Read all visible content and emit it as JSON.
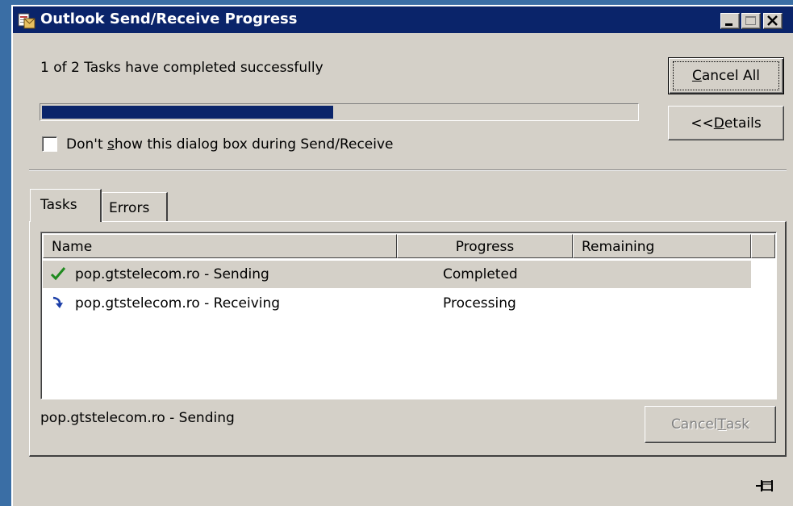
{
  "window": {
    "title": "Outlook Send/Receive Progress"
  },
  "status": {
    "message": "1 of 2 Tasks have completed successfully",
    "progress_fraction": 0.49
  },
  "buttons": {
    "cancel_all": {
      "before": "",
      "mnemonic": "C",
      "after": "ancel All"
    },
    "details": {
      "before": "<< ",
      "mnemonic": "D",
      "after": "etails"
    },
    "cancel_task": {
      "before": "Cancel ",
      "mnemonic": "T",
      "after": "ask"
    }
  },
  "checkbox": {
    "before": "Don't ",
    "mnemonic": "s",
    "after": "how this dialog box during Send/Receive",
    "checked": false
  },
  "tabs": [
    {
      "label": "Tasks",
      "active": true
    },
    {
      "label": "Errors",
      "active": false
    }
  ],
  "task_list": {
    "columns": [
      "Name",
      "Progress",
      "Remaining"
    ],
    "rows": [
      {
        "icon": "checkmark-icon",
        "name": "pop.gtstelecom.ro - Sending",
        "progress": "Completed",
        "remaining": ""
      },
      {
        "icon": "receive-arrow-icon",
        "name": "pop.gtstelecom.ro - Receiving",
        "progress": "Processing",
        "remaining": ""
      }
    ]
  },
  "selected_task_label": "pop.gtstelecom.ro - Sending",
  "colors": {
    "title_bar": "#0a246a",
    "progress_fill": "#0a246a",
    "check_green": "#1f8a1f",
    "arrow_blue": "#1c3fa8"
  }
}
